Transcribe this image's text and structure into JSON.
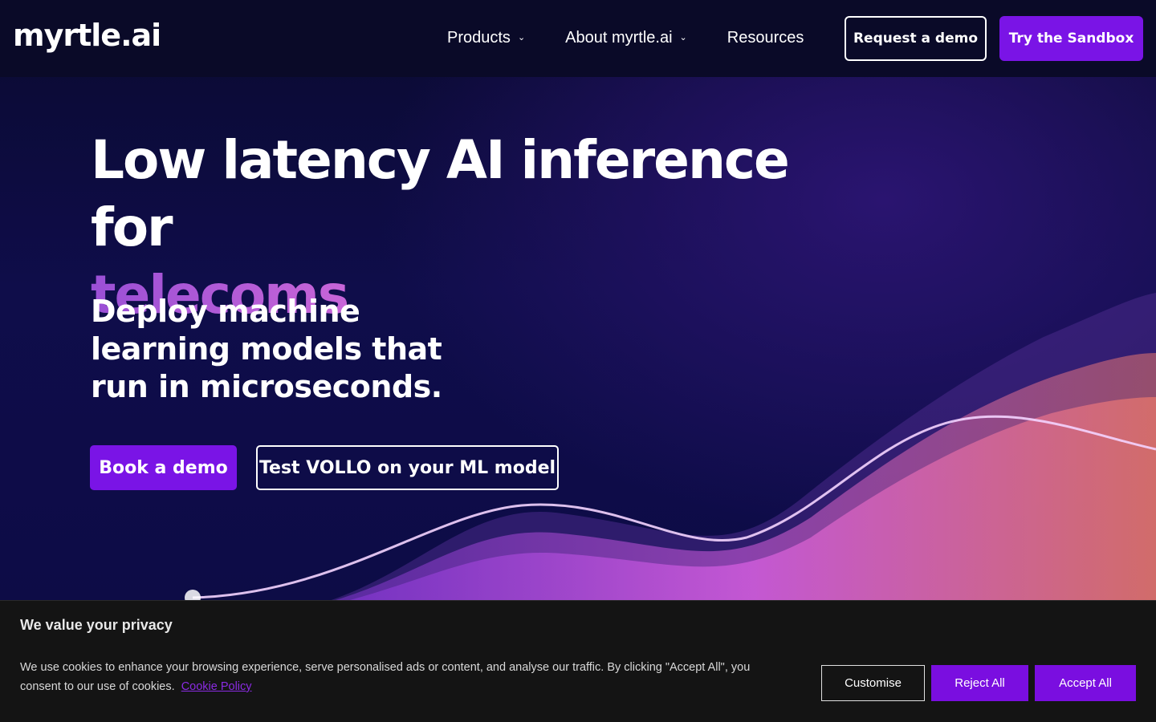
{
  "brand": {
    "logo_text": "myrtle.ai"
  },
  "nav": {
    "items": [
      {
        "label": "Products",
        "has_dropdown": true
      },
      {
        "label": "About myrtle.ai",
        "has_dropdown": true
      },
      {
        "label": "Resources",
        "has_dropdown": false
      }
    ],
    "request_demo_label": "Request a demo",
    "sandbox_label": "Try the Sandbox"
  },
  "hero": {
    "headline": "Low latency AI inference for",
    "headline_accent": "telecoms",
    "subheadline": "Deploy machine learning models that run in microseconds.",
    "book_demo_label": "Book a demo",
    "test_vollo_label": "Test VOLLO on your ML model"
  },
  "cookie_banner": {
    "title": "We value your privacy",
    "text": "We use cookies to enhance your browsing experience, serve personalised ads or content, and analyse our traffic. By clicking \"Accept All\", you consent to our use of cookies.",
    "link_label": "Cookie Policy",
    "customise_label": "Customise",
    "reject_label": "Reject All",
    "accept_label": "Accept All"
  },
  "colors": {
    "accent": "#7a14e6",
    "background": "#0b0b3a",
    "banner_bg": "#141414",
    "link": "#8a2be2"
  }
}
